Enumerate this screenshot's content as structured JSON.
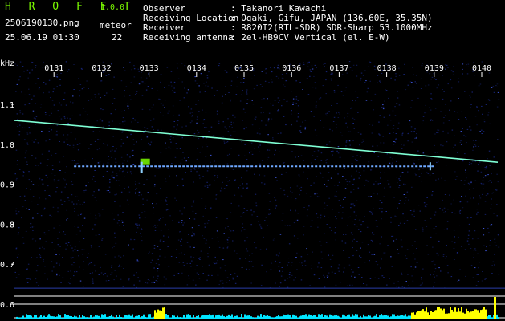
{
  "header": {
    "app_title": "H R O F F T",
    "version": "1.0.0",
    "filename": "2506190130.png",
    "datetime": "25.06.19 01:30",
    "meteor_label": "meteor",
    "meteor_count": "22"
  },
  "info": [
    {
      "key": "Observer",
      "value": ": Takanori Kawachi"
    },
    {
      "key": "Receiving Location",
      "value": ": Ogaki, Gifu, JAPAN (136.60E, 35.35N)"
    },
    {
      "key": "Receiver",
      "value": ": R820T2(RTL-SDR) SDR-Sharp 53.1000MHz"
    },
    {
      "key": "Receiving antenna",
      "value": ": 2el-HB9CV Vertical (el. E-W)"
    }
  ],
  "chart_data": {
    "type": "spectrogram",
    "ylabel": "kHz",
    "x_tick_labels": [
      "0131",
      "0132",
      "0133",
      "0134",
      "0135",
      "0136",
      "0137",
      "0138",
      "0139",
      "0140"
    ],
    "y_tick_labels": [
      "1.1",
      "1.0",
      "0.9",
      "0.8",
      "0.7",
      "0.6"
    ],
    "y_ticks": [
      1.1,
      1.0,
      0.9,
      0.8,
      0.7,
      0.6
    ],
    "ylim": [
      0.59,
      1.16
    ],
    "traces": [
      {
        "name": "",
        "x_start": "0130",
        "x_end": "0140",
        "y_start": 1.06,
        "y_end": 0.955,
        "color": "#7fffd4"
      },
      {
        "name": "",
        "x_start": "0131",
        "x_end": "0140",
        "y_start": 0.945,
        "y_end": 0.945,
        "color": "#6fa8ff"
      }
    ],
    "colors": {
      "background": "#000000",
      "noise": "#1a2a8a",
      "meteor": "#7CFC00",
      "bars": "#00e5ff",
      "bars_hot": "#ffff00"
    }
  }
}
